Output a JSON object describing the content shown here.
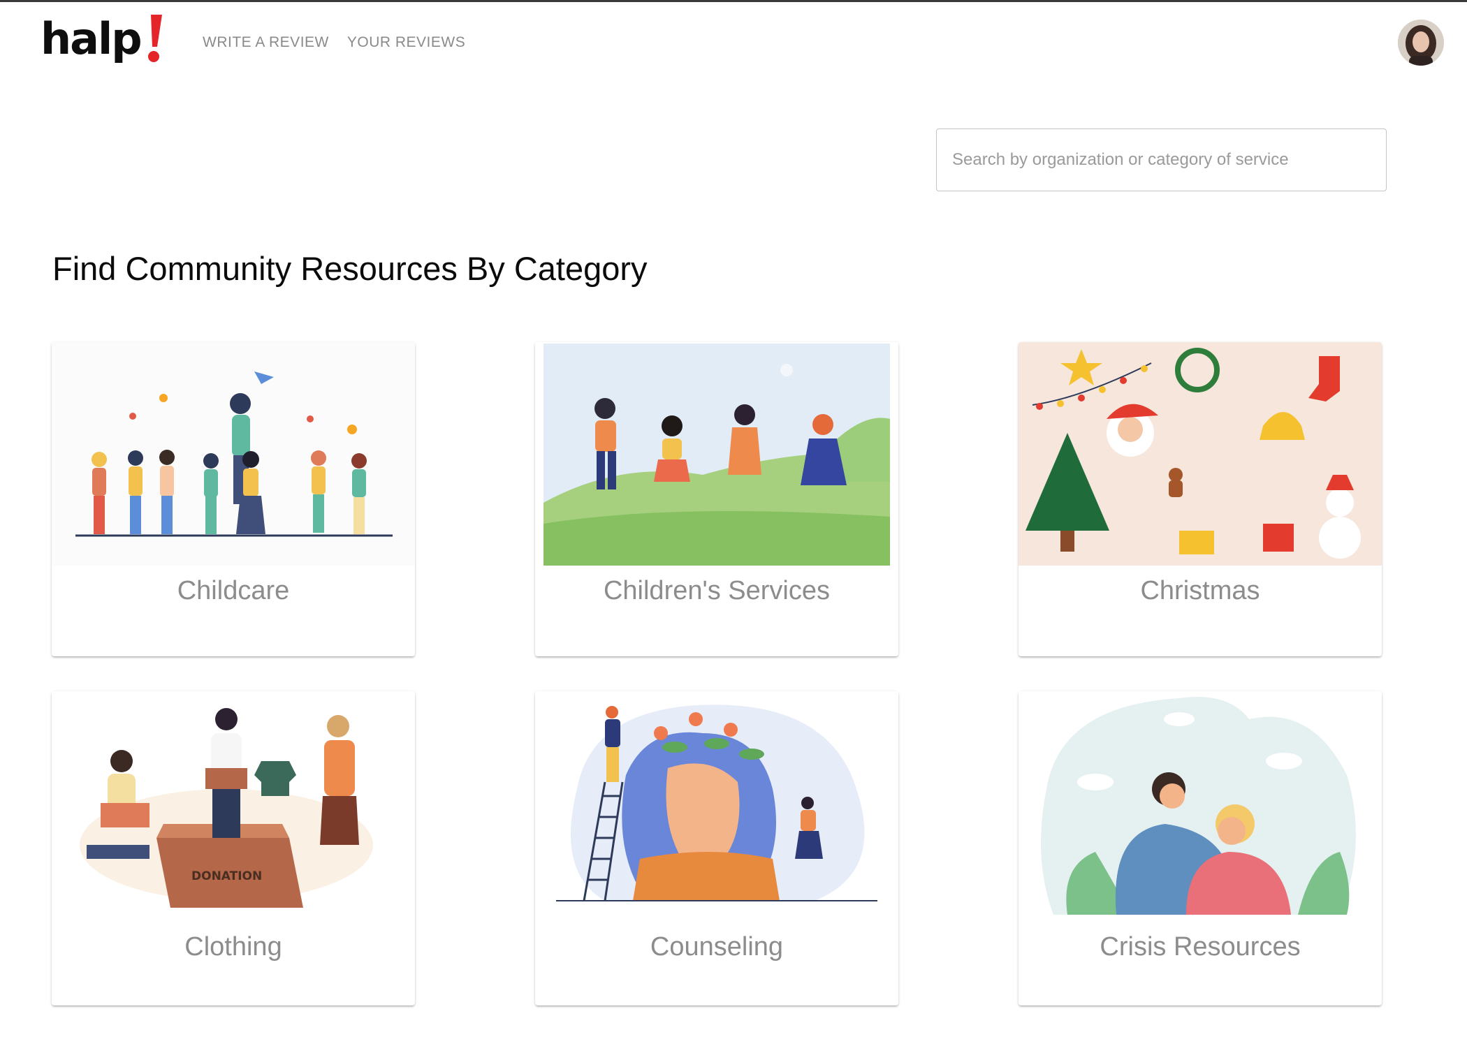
{
  "brand": {
    "name": "halp!",
    "accent": "#e4262b"
  },
  "nav": {
    "items": [
      {
        "label": "WRITE A REVIEW"
      },
      {
        "label": "YOUR REVIEWS"
      }
    ]
  },
  "search": {
    "placeholder": "Search by organization or category of service"
  },
  "page": {
    "title": "Find Community Resources By Category"
  },
  "categories": [
    {
      "label": "Childcare"
    },
    {
      "label": "Children's Services"
    },
    {
      "label": "Christmas"
    },
    {
      "label": "Clothing"
    },
    {
      "label": "Counseling"
    },
    {
      "label": "Crisis Resources"
    }
  ],
  "illustrations": {
    "donation_box_text": "DONATION"
  },
  "colors": {
    "nav_text": "#8a8a8a",
    "card_label": "#8c8c8c",
    "border": "#c4c4c4"
  }
}
